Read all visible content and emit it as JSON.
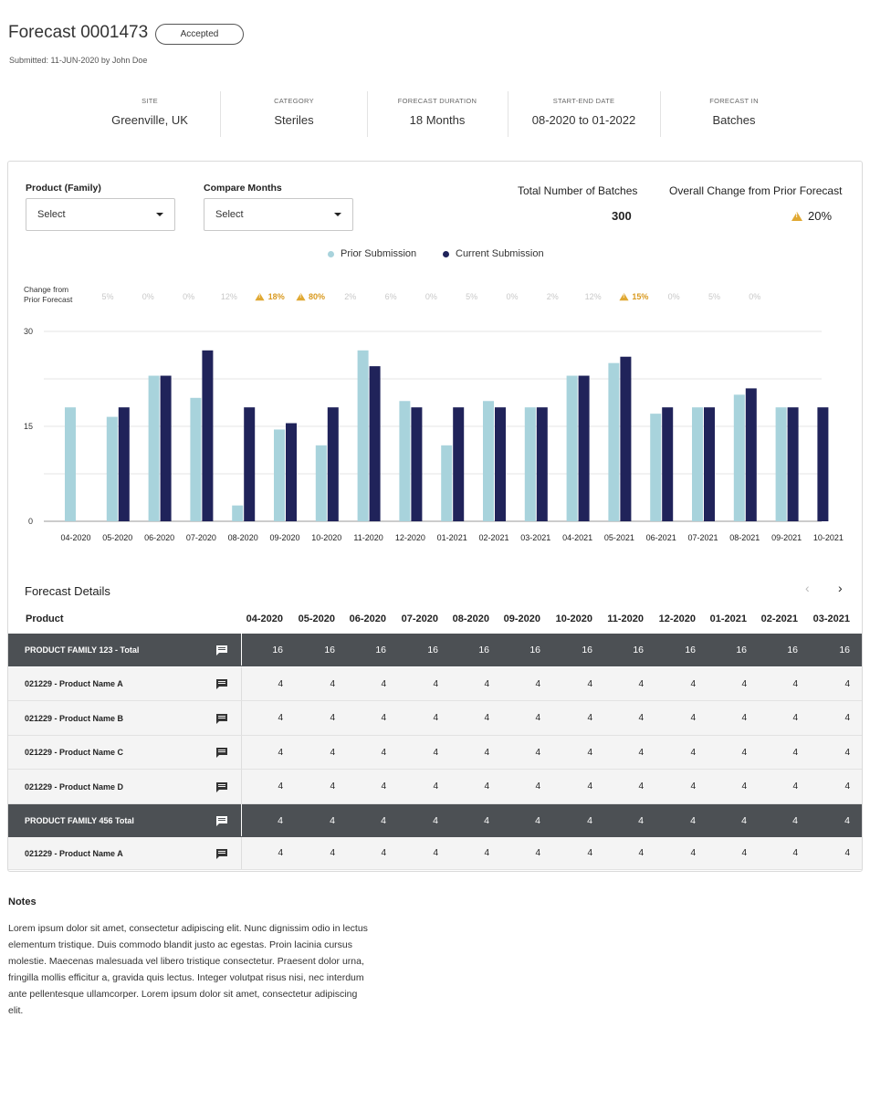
{
  "header": {
    "title": "Forecast 0001473",
    "status": "Accepted",
    "submitted": "Submitted: 11-JUN-2020 by John Doe"
  },
  "meta": [
    {
      "label": "SITE",
      "value": "Greenville, UK"
    },
    {
      "label": "CATEGORY",
      "value": "Steriles"
    },
    {
      "label": "FORECAST DURATION",
      "value": "18 Months"
    },
    {
      "label": "START-END DATE",
      "value": "08-2020 to 01-2022"
    },
    {
      "label": "FORECAST IN",
      "value": "Batches"
    }
  ],
  "filters": {
    "product_label": "Product (Family)",
    "product_value": "Select",
    "compare_label": "Compare Months",
    "compare_value": "Select"
  },
  "stats": {
    "total_label": "Total Number of Batches",
    "total_value": "300",
    "change_label": "Overall Change from Prior Forecast",
    "change_value": "20%"
  },
  "colors": {
    "prior": "#a8d3dc",
    "current": "#20235a",
    "warning": "#e0a832",
    "total_row": "#4c5054"
  },
  "change_row": {
    "label_line1": "Change from",
    "label_line2": "Prior Forecast",
    "values": [
      "5%",
      "0%",
      "0%",
      "12%",
      "18%",
      "80%",
      "2%",
      "6%",
      "0%",
      "5%",
      "0%",
      "2%",
      "12%",
      "15%",
      "0%",
      "5%",
      "0%"
    ],
    "highlight": [
      false,
      false,
      false,
      false,
      true,
      true,
      false,
      false,
      false,
      false,
      false,
      false,
      false,
      true,
      false,
      false,
      false
    ]
  },
  "chart_data": {
    "type": "bar",
    "categories": [
      "04-2020",
      "05-2020",
      "06-2020",
      "07-2020",
      "08-2020",
      "09-2020",
      "10-2020",
      "11-2020",
      "12-2020",
      "01-2021",
      "02-2021",
      "03-2021",
      "04-2021",
      "05-2021",
      "06-2021",
      "07-2021",
      "08-2021",
      "09-2021",
      "10-2021"
    ],
    "series": [
      {
        "name": "Prior Submission",
        "values": [
          18,
          16.5,
          23,
          19.5,
          2.5,
          14.5,
          12,
          27,
          19,
          12,
          19,
          18,
          23,
          25,
          17,
          18,
          20,
          18,
          0
        ]
      },
      {
        "name": "Current Submission",
        "values": [
          null,
          18,
          23,
          27,
          18,
          15.5,
          18,
          24.5,
          18,
          18,
          18,
          18,
          23,
          26,
          18,
          18,
          21,
          18,
          18
        ]
      }
    ],
    "yticks": [
      "0",
      "15",
      "30"
    ],
    "ylim": [
      0,
      30
    ],
    "legend": "top-center",
    "grid": true
  },
  "details": {
    "title": "Forecast Details",
    "product_header": "Product",
    "months": [
      "04-2020",
      "05-2020",
      "06-2020",
      "07-2020",
      "08-2020",
      "09-2020",
      "10-2020",
      "11-2020",
      "12-2020",
      "01-2021",
      "02-2021",
      "03-2021"
    ],
    "rows": [
      {
        "name": "PRODUCT FAMILY 123 - Total",
        "type": "total",
        "values": [
          "16",
          "16",
          "16",
          "16",
          "16",
          "16",
          "16",
          "16",
          "16",
          "16",
          "16",
          "16"
        ]
      },
      {
        "name": "021229 - Product Name A",
        "type": "item",
        "values": [
          "4",
          "4",
          "4",
          "4",
          "4",
          "4",
          "4",
          "4",
          "4",
          "4",
          "4",
          "4"
        ]
      },
      {
        "name": "021229 - Product Name B",
        "type": "item",
        "values": [
          "4",
          "4",
          "4",
          "4",
          "4",
          "4",
          "4",
          "4",
          "4",
          "4",
          "4",
          "4"
        ]
      },
      {
        "name": "021229 - Product Name C",
        "type": "item",
        "values": [
          "4",
          "4",
          "4",
          "4",
          "4",
          "4",
          "4",
          "4",
          "4",
          "4",
          "4",
          "4"
        ]
      },
      {
        "name": "021229 - Product Name D",
        "type": "item",
        "values": [
          "4",
          "4",
          "4",
          "4",
          "4",
          "4",
          "4",
          "4",
          "4",
          "4",
          "4",
          "4"
        ]
      },
      {
        "name": "PRODUCT FAMILY 456 Total",
        "type": "total",
        "values": [
          "4",
          "4",
          "4",
          "4",
          "4",
          "4",
          "4",
          "4",
          "4",
          "4",
          "4",
          "4"
        ]
      },
      {
        "name": "021229 - Product Name A",
        "type": "item",
        "values": [
          "4",
          "4",
          "4",
          "4",
          "4",
          "4",
          "4",
          "4",
          "4",
          "4",
          "4",
          "4"
        ]
      }
    ]
  },
  "notes": {
    "title": "Notes",
    "body": "Lorem ipsum dolor sit amet, consectetur adipiscing elit. Nunc dignissim odio in lectus elementum tristique. Duis commodo blandit justo ac egestas. Proin lacinia cursus molestie. Maecenas malesuada vel libero tristique consectetur. Praesent dolor urna, fringilla mollis efficitur a, gravida quis lectus. Integer volutpat risus nisi, nec interdum ante pellentesque ullamcorper. Lorem ipsum dolor sit amet, consectetur adipiscing elit."
  }
}
